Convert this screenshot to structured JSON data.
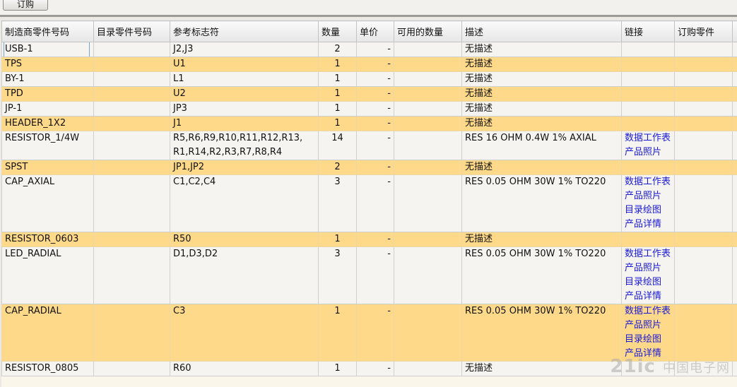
{
  "toolbar": {
    "order_button": "订购"
  },
  "table": {
    "columns": [
      "制造商零件号码",
      "目录零件号码",
      "参考标志符",
      "数量",
      "单价",
      "可用的数量",
      "描述",
      "链接",
      "订购零件"
    ],
    "rows": [
      {
        "mpn": "USB-1",
        "catalog": "",
        "ref": [
          "J2,J3"
        ],
        "qty": "2",
        "price": "-",
        "avail": "",
        "desc": "无描述",
        "links": []
      },
      {
        "mpn": "TPS",
        "catalog": "",
        "ref": [
          "U1"
        ],
        "qty": "1",
        "price": "-",
        "avail": "",
        "desc": "无描述",
        "links": []
      },
      {
        "mpn": "BY-1",
        "catalog": "",
        "ref": [
          "L1"
        ],
        "qty": "1",
        "price": "-",
        "avail": "",
        "desc": "无描述",
        "links": []
      },
      {
        "mpn": "TPD",
        "catalog": "",
        "ref": [
          "U2"
        ],
        "qty": "1",
        "price": "-",
        "avail": "",
        "desc": "无描述",
        "links": []
      },
      {
        "mpn": "JP-1",
        "catalog": "",
        "ref": [
          "JP3"
        ],
        "qty": "1",
        "price": "-",
        "avail": "",
        "desc": "无描述",
        "links": []
      },
      {
        "mpn": "HEADER_1X2",
        "catalog": "",
        "ref": [
          "J1"
        ],
        "qty": "1",
        "price": "-",
        "avail": "",
        "desc": "无描述",
        "links": []
      },
      {
        "mpn": "RESISTOR_1/4W",
        "catalog": "",
        "ref": [
          "R5,R6,R9,R10,R11,R12,R13,",
          "R1,R14,R2,R3,R7,R8,R4"
        ],
        "qty": "14",
        "price": "-",
        "avail": "",
        "desc": "RES 16 OHM 0.4W 1% AXIAL",
        "links": [
          "数据工作表",
          "产品照片"
        ]
      },
      {
        "mpn": "SPST",
        "catalog": "",
        "ref": [
          "JP1,JP2"
        ],
        "qty": "2",
        "price": "-",
        "avail": "",
        "desc": "无描述",
        "links": []
      },
      {
        "mpn": "CAP_AXIAL",
        "catalog": "",
        "ref": [
          "C1,C2,C4"
        ],
        "qty": "3",
        "price": "-",
        "avail": "",
        "desc": "RES 0.05 OHM 30W 1% TO220",
        "links": [
          "数据工作表",
          "产品照片",
          "目录绘图",
          "产品详情"
        ]
      },
      {
        "mpn": "RESISTOR_0603",
        "catalog": "",
        "ref": [
          "R50"
        ],
        "qty": "1",
        "price": "-",
        "avail": "",
        "desc": "无描述",
        "links": []
      },
      {
        "mpn": "LED_RADIAL",
        "catalog": "",
        "ref": [
          "D1,D3,D2"
        ],
        "qty": "3",
        "price": "-",
        "avail": "",
        "desc": "RES 0.05 OHM 30W 1% TO220",
        "links": [
          "数据工作表",
          "产品照片",
          "目录绘图",
          "产品详情"
        ]
      },
      {
        "mpn": "CAP_RADIAL",
        "catalog": "",
        "ref": [
          "C3"
        ],
        "qty": "1",
        "price": "-",
        "avail": "",
        "desc": "RES 0.05 OHM 30W 1% TO220",
        "links": [
          "数据工作表",
          "产品照片",
          "目录绘图",
          "产品详情"
        ]
      },
      {
        "mpn": "RESISTOR_0805",
        "catalog": "",
        "ref": [
          "R60"
        ],
        "qty": "1",
        "price": "-",
        "avail": "",
        "desc": "无描述",
        "links": []
      }
    ]
  },
  "watermark": {
    "brand": "21ic",
    "site": "中国电子网"
  }
}
